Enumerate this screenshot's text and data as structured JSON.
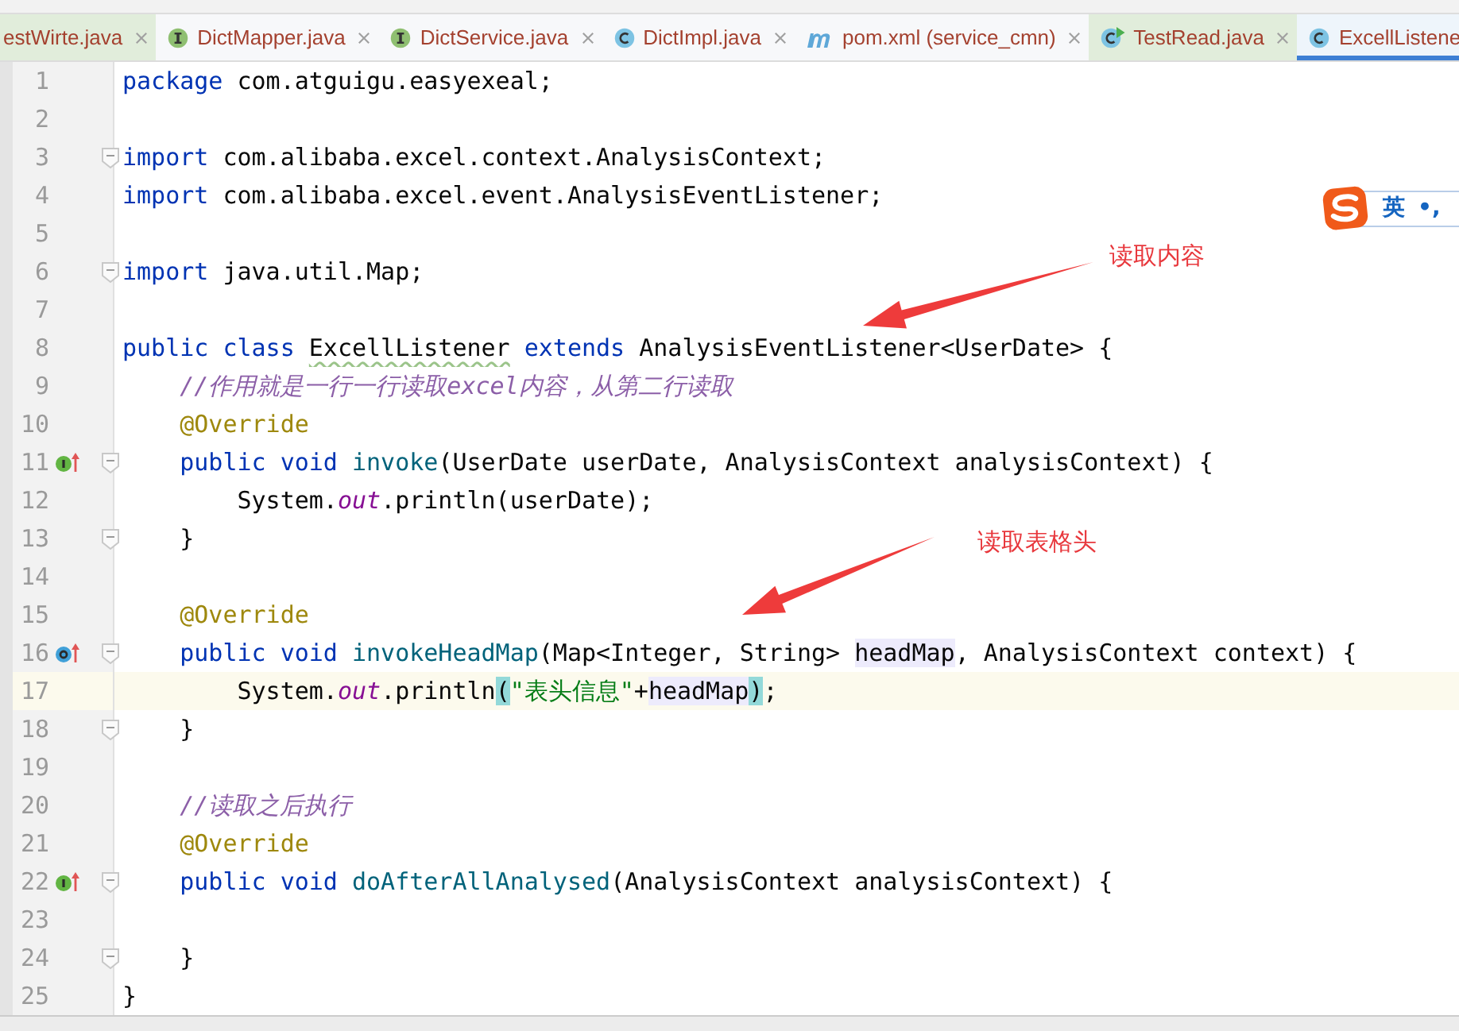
{
  "tabs": [
    {
      "kind": "test",
      "label": "estWirte.java",
      "selected": false,
      "tinted": true
    },
    {
      "kind": "interface",
      "label": "DictMapper.java",
      "selected": false,
      "tinted": false
    },
    {
      "kind": "interface",
      "label": "DictService.java",
      "selected": false,
      "tinted": false
    },
    {
      "kind": "class",
      "label": "DictImpl.java",
      "selected": false,
      "tinted": false
    },
    {
      "kind": "maven",
      "label": "pom.xml (service_cmn)",
      "selected": false,
      "tinted": false
    },
    {
      "kind": "test",
      "label": "TestRead.java",
      "selected": false,
      "tinted": true
    },
    {
      "kind": "class",
      "label": "ExcellListene",
      "selected": true,
      "tinted": false
    }
  ],
  "editor": {
    "lines": [
      {
        "number": "1",
        "fold": false,
        "current": false,
        "tokens": [
          {
            "kind": "keyword",
            "text": "package"
          },
          {
            "kind": "plain",
            "text": " com.atguigu.easyexeal;"
          }
        ]
      },
      {
        "number": "2",
        "fold": false,
        "current": false
      },
      {
        "number": "3",
        "fold": true,
        "current": false,
        "tokens": [
          {
            "kind": "keyword",
            "text": "import"
          },
          {
            "kind": "plain",
            "text": " com.alibaba.excel.context.AnalysisContext;"
          }
        ]
      },
      {
        "number": "4",
        "fold": false,
        "current": false,
        "tokens": [
          {
            "kind": "keyword",
            "text": "import"
          },
          {
            "kind": "plain",
            "text": " com.alibaba.excel.event.AnalysisEventListener;"
          }
        ]
      },
      {
        "number": "5",
        "fold": false,
        "current": false
      },
      {
        "number": "6",
        "fold": true,
        "current": false,
        "tokens": [
          {
            "kind": "keyword",
            "text": "import"
          },
          {
            "kind": "plain",
            "text": " java.util.Map;"
          }
        ]
      },
      {
        "number": "7",
        "fold": false,
        "current": false
      },
      {
        "number": "8",
        "fold": false,
        "current": false,
        "tokens": [
          {
            "kind": "keyword",
            "text": "public class "
          },
          {
            "kind": "typo",
            "text": "ExcellListener"
          },
          {
            "kind": "keyword",
            "text": " extends "
          },
          {
            "kind": "plain",
            "text": "AnalysisEventListener<UserDate> {"
          }
        ]
      },
      {
        "number": "9",
        "fold": false,
        "current": false,
        "tokens": [
          {
            "kind": "comment",
            "text": "    //作用就是一行一行读取excel内容，从第二行读取"
          }
        ]
      },
      {
        "number": "10",
        "fold": false,
        "current": false,
        "tokens": [
          {
            "kind": "annotation",
            "text": "    @Override"
          }
        ]
      },
      {
        "number": "11",
        "fold": true,
        "current": false,
        "kind": "implements",
        "tokens": [
          {
            "kind": "keyword",
            "text": "    public void "
          },
          {
            "kind": "method",
            "text": "invoke"
          },
          {
            "kind": "plain",
            "text": "(UserDate userDate, AnalysisContext analysisContext) {"
          }
        ]
      },
      {
        "number": "12",
        "fold": false,
        "current": false,
        "tokens": [
          {
            "kind": "plain",
            "text": "        System."
          },
          {
            "kind": "field",
            "text": "out"
          },
          {
            "kind": "plain",
            "text": ".println(userDate);"
          }
        ]
      },
      {
        "number": "13",
        "fold": true,
        "current": false,
        "tokens": [
          {
            "kind": "plain",
            "text": "    }"
          }
        ]
      },
      {
        "number": "14",
        "fold": false,
        "current": false
      },
      {
        "number": "15",
        "fold": false,
        "current": false,
        "tokens": [
          {
            "kind": "annotation",
            "text": "    @Override"
          }
        ]
      },
      {
        "number": "16",
        "fold": true,
        "current": false,
        "kind": "overrides",
        "tokens": [
          {
            "kind": "keyword",
            "text": "    public void "
          },
          {
            "kind": "method",
            "text": "invokeHeadMap"
          },
          {
            "kind": "plain",
            "text": "(Map<Integer, String> "
          },
          {
            "kind": "usage",
            "text": "headMap"
          },
          {
            "kind": "plain",
            "text": ", AnalysisContext context) {"
          }
        ]
      },
      {
        "number": "17",
        "fold": false,
        "current": true,
        "tokens": [
          {
            "kind": "plain",
            "text": "        System."
          },
          {
            "kind": "field",
            "text": "out"
          },
          {
            "kind": "plain",
            "text": ".println"
          },
          {
            "kind": "brace",
            "text": "("
          },
          {
            "kind": "string",
            "text": "\"表头信息\""
          },
          {
            "kind": "plain",
            "text": "+"
          },
          {
            "kind": "usage",
            "text": "headMap"
          },
          {
            "kind": "brace",
            "text": ")"
          },
          {
            "kind": "plain",
            "text": ";"
          }
        ]
      },
      {
        "number": "18",
        "fold": true,
        "current": false,
        "tokens": [
          {
            "kind": "plain",
            "text": "    }"
          }
        ]
      },
      {
        "number": "19",
        "fold": false,
        "current": false
      },
      {
        "number": "20",
        "fold": false,
        "current": false,
        "tokens": [
          {
            "kind": "comment",
            "text": "    //读取之后执行"
          }
        ]
      },
      {
        "number": "21",
        "fold": false,
        "current": false,
        "tokens": [
          {
            "kind": "annotation",
            "text": "    @Override"
          }
        ]
      },
      {
        "number": "22",
        "fold": true,
        "current": false,
        "kind": "implements",
        "tokens": [
          {
            "kind": "keyword",
            "text": "    public void "
          },
          {
            "kind": "method",
            "text": "doAfterAllAnalysed"
          },
          {
            "kind": "plain",
            "text": "(AnalysisContext analysisContext) {"
          }
        ]
      },
      {
        "number": "23",
        "fold": false,
        "current": false
      },
      {
        "number": "24",
        "fold": true,
        "current": false,
        "tokens": [
          {
            "kind": "plain",
            "text": "    }"
          }
        ]
      },
      {
        "number": "25",
        "fold": false,
        "current": false,
        "tokens": [
          {
            "kind": "plain",
            "text": "}"
          }
        ]
      }
    ]
  },
  "callouts": [
    {
      "text": "读取内容"
    },
    {
      "text": "读取表格头"
    }
  ],
  "ime": {
    "mode": "英",
    "punctuation": "•,"
  }
}
